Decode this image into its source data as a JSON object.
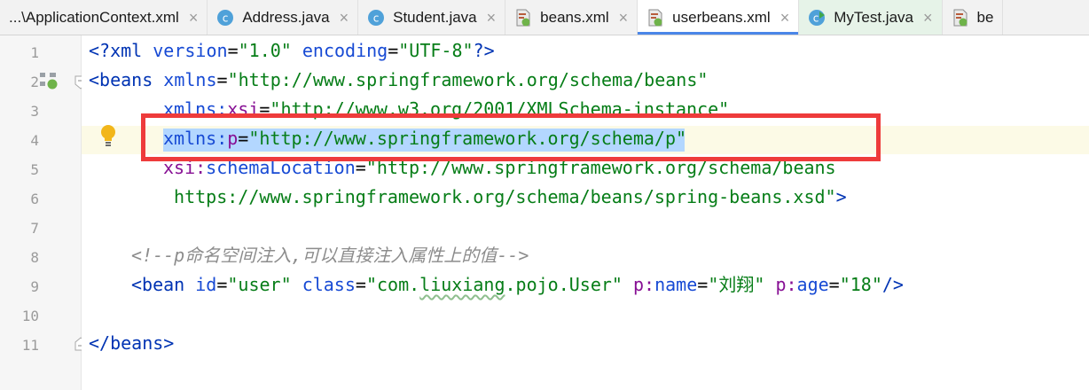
{
  "tabs": [
    {
      "label": "...\\ApplicationContext.xml",
      "icon": "none",
      "close": "×"
    },
    {
      "label": "Address.java",
      "icon": "java-class-icon",
      "close": "×"
    },
    {
      "label": "Student.java",
      "icon": "java-class-icon",
      "close": "×"
    },
    {
      "label": "beans.xml",
      "icon": "spring-xml-icon",
      "close": "×"
    },
    {
      "label": "userbeans.xml",
      "icon": "spring-xml-icon",
      "close": "×",
      "active": true
    },
    {
      "label": "MyTest.java",
      "icon": "java-test-icon",
      "close": "×"
    },
    {
      "label": "be",
      "icon": "spring-xml-icon"
    }
  ],
  "line_numbers": [
    "1",
    "2",
    "3",
    "4",
    "5",
    "6",
    "7",
    "8",
    "9",
    "10",
    "11"
  ],
  "code": {
    "l1": {
      "open": "<?",
      "xml": "xml ",
      "version_attr": "version",
      "eq1": "=",
      "version_val": "\"1.0\"",
      "space": " ",
      "enc_attr": "encoding",
      "eq2": "=",
      "enc_val": "\"UTF-8\"",
      "close": "?>"
    },
    "l2": {
      "open": "<beans ",
      "attr": "xmlns",
      "eq": "=",
      "val": "\"http://www.springframework.org/schema/beans\""
    },
    "l3": {
      "ns": "xmlns:",
      "attr": "xsi",
      "eq": "=",
      "val": "\"http://www.w3.org/2001/XMLSchema-instance\""
    },
    "l4": {
      "ns": "xmlns:",
      "attr": "p",
      "eq": "=",
      "val": "\"http://www.springframework.org/schema/p\""
    },
    "l5": {
      "ns": "xsi:",
      "attr": "schemaLocation",
      "eq": "=",
      "val": "\"http://www.springframework.org/schema/beans"
    },
    "l6": {
      "val": " https://www.springframework.org/schema/beans/spring-beans.xsd\"",
      "close": ">"
    },
    "l8": {
      "comment": "<!--p命名空间注入,可以直接注入属性上的值-->"
    },
    "l9": {
      "open": "<bean ",
      "id_attr": "id",
      "eq1": "=",
      "id_val": "\"user\"",
      "sp1": " ",
      "class_attr": "class",
      "eq2": "=",
      "class_q1": "\"com.",
      "class_squiggle": "liuxiang",
      "class_rest": ".pojo.User\"",
      "sp2": " ",
      "pname_ns": "p:",
      "pname_attr": "name",
      "eq3": "=",
      "pname_val": "\"刘翔\"",
      "sp3": " ",
      "page_ns": "p:",
      "page_attr": "age",
      "eq4": "=",
      "page_val": "\"18\"",
      "close": "/>"
    },
    "l11": {
      "close": "</beans>"
    }
  }
}
